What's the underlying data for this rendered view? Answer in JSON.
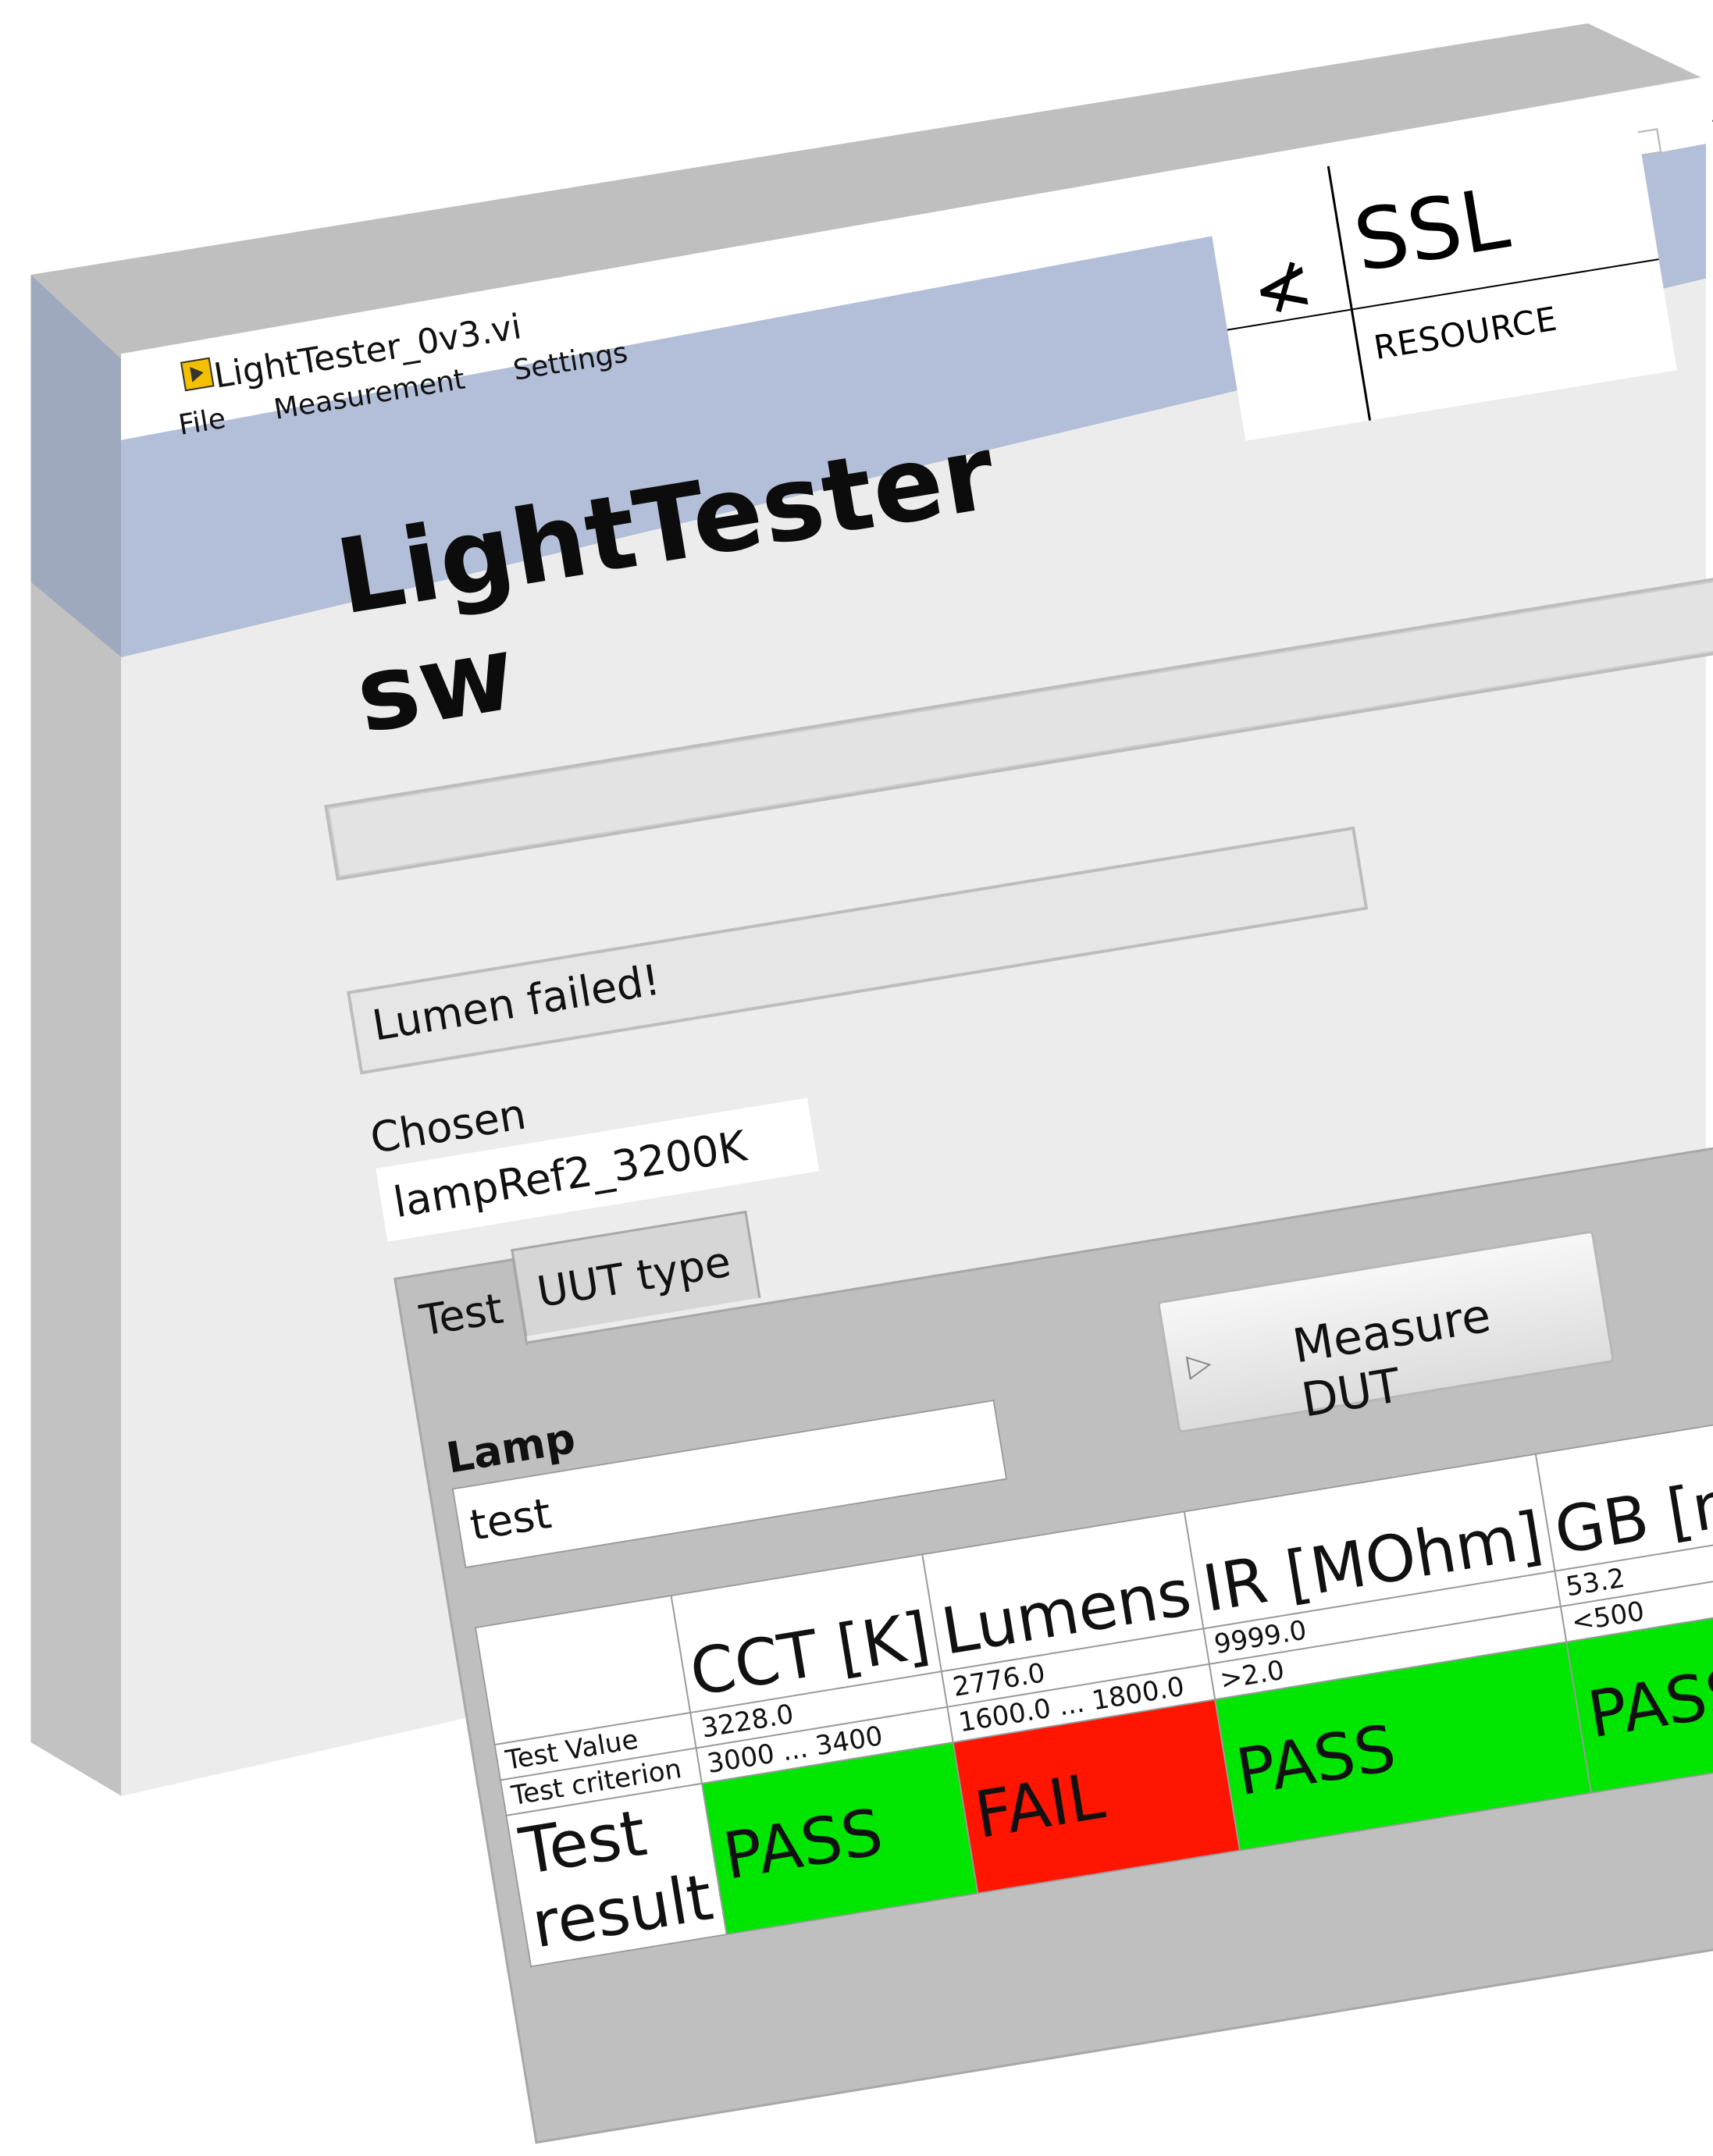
{
  "window": {
    "title": "LightTester_0v3.vi",
    "minimize": "–",
    "maximize": "□",
    "close": "×"
  },
  "menu": [
    "File",
    "Measurement",
    "Settings"
  ],
  "header": {
    "title": "LightTester sw",
    "logo": {
      "main": "SSL",
      "sub": "RESOURCE"
    }
  },
  "status": {
    "message": "Lumen failed!"
  },
  "chosen_uut": {
    "label": "Chosen UUT",
    "value": "lampRef2_3200K"
  },
  "tabs": [
    {
      "label": "Test",
      "selected": true
    },
    {
      "label": "UUT type",
      "selected": false
    }
  ],
  "lamp_id": {
    "label": "Lamp ID",
    "value": "test"
  },
  "measure_button": {
    "label": "Measure DUT",
    "icon": "play-arrow-icon"
  },
  "results": {
    "columns": [
      "CCT [K]",
      "Lumens",
      "IR [MOhm]",
      "GB [mOhm]"
    ],
    "row_labels": [
      "Test Value",
      "Test criterion",
      "Test result"
    ],
    "test_values": [
      "3228.0",
      "2776.0",
      "9999.0",
      "53.2"
    ],
    "criteria": [
      "3000 ... 3400",
      "1600.0 ... 1800.0",
      ">2.0",
      "<500"
    ],
    "outcomes": [
      "PASS",
      "FAIL",
      "PASS",
      "PASS"
    ]
  },
  "colors": {
    "header_band": "#b3bfd8",
    "window_bg": "#ececec",
    "panel_bg": "#bfbfbf",
    "pass": "#00e600",
    "fail": "#ff1500"
  }
}
